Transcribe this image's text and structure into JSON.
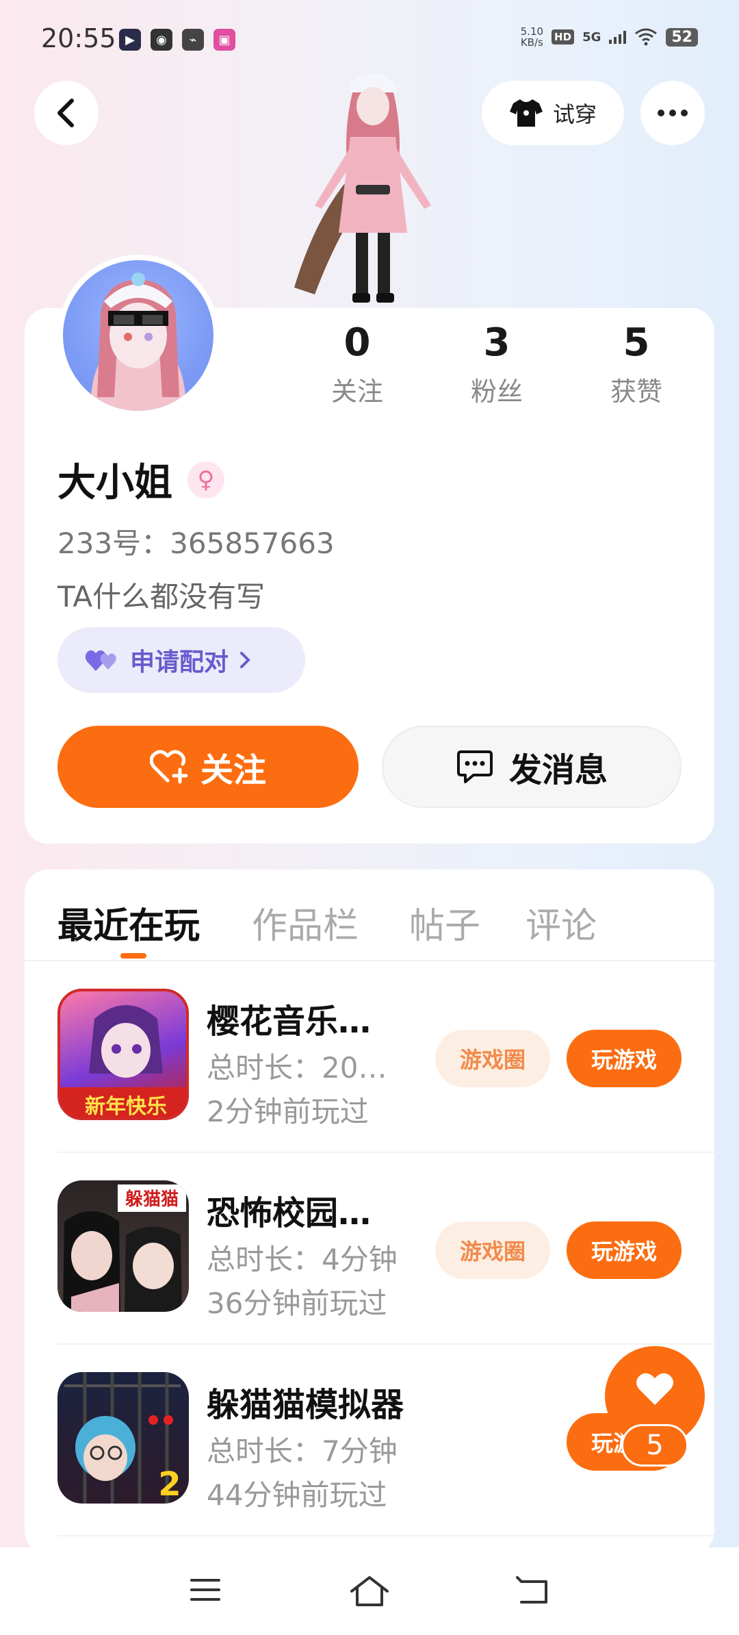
{
  "status_bar": {
    "time": "20:55",
    "net_speed_value": "5.10",
    "net_speed_unit": "KB/s",
    "hd": "HD",
    "network": "5G",
    "battery": "52"
  },
  "header": {
    "try_on_label": "试穿"
  },
  "profile": {
    "stats": [
      {
        "value": "0",
        "label": "关注"
      },
      {
        "value": "3",
        "label": "粉丝"
      },
      {
        "value": "5",
        "label": "获赞"
      }
    ],
    "name": "大小姐",
    "gender_symbol": "♀",
    "uid": "233号：365857663",
    "bio": "TA什么都没有写",
    "match_label": "申请配对",
    "follow_label": "关注",
    "message_label": "发消息"
  },
  "tabs": [
    "最近在玩",
    "作品栏",
    "帖子",
    "评论"
  ],
  "games": [
    {
      "title": "樱花音乐…",
      "duration": "总时长：20…",
      "last_played": "2分钟前玩过",
      "circle_label": "游戏圈",
      "play_label": "玩游戏",
      "icon_text": "新年快乐"
    },
    {
      "title": "恐怖校园…",
      "duration": "总时长：4分钟",
      "last_played": "36分钟前玩过",
      "circle_label": "游戏圈",
      "play_label": "玩游戏",
      "icon_text": "躲猫猫"
    },
    {
      "title": "躲猫猫模拟器",
      "duration": "总时长：7分钟",
      "last_played": "44分钟前玩过",
      "play_label": "玩游戏",
      "icon_text": "2"
    }
  ],
  "like_fab": {
    "count": "5"
  },
  "colors": {
    "accent": "#fb6d10",
    "match": "#6a5acd",
    "gender": "#f06e9b"
  }
}
